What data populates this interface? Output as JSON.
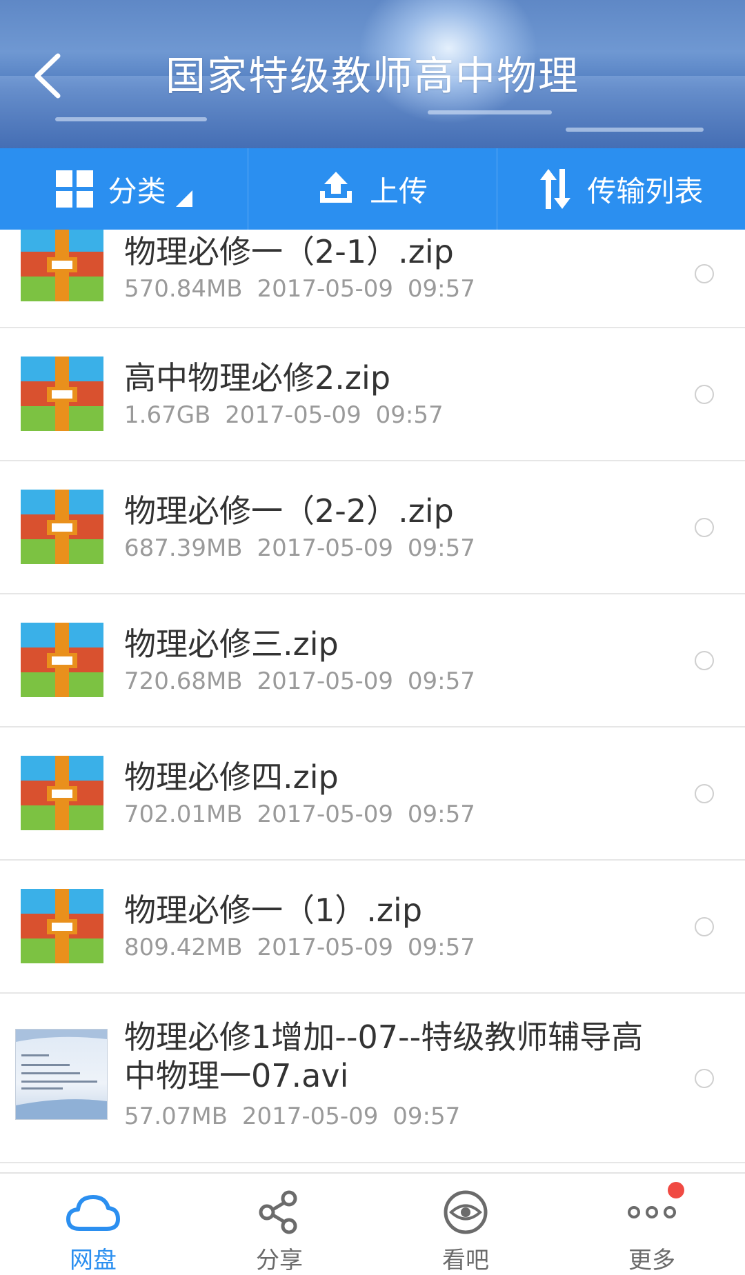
{
  "header": {
    "title": "国家特级教师高中物理"
  },
  "toolbar": {
    "category_label": "分类",
    "upload_label": "上传",
    "transfer_label": "传输列表"
  },
  "files": [
    {
      "name": "物理必修一（2-1）.zip",
      "size": "570.84MB",
      "date": "2017-05-09",
      "time": "09:57",
      "icon": "zip-archive-icon"
    },
    {
      "name": "高中物理必修2.zip",
      "size": "1.67GB",
      "date": "2017-05-09",
      "time": "09:57",
      "icon": "zip-archive-icon"
    },
    {
      "name": "物理必修一（2-2）.zip",
      "size": "687.39MB",
      "date": "2017-05-09",
      "time": "09:57",
      "icon": "zip-archive-icon"
    },
    {
      "name": "物理必修三.zip",
      "size": "720.68MB",
      "date": "2017-05-09",
      "time": "09:57",
      "icon": "zip-archive-icon"
    },
    {
      "name": "物理必修四.zip",
      "size": "702.01MB",
      "date": "2017-05-09",
      "time": "09:57",
      "icon": "zip-archive-icon"
    },
    {
      "name": "物理必修一（1）.zip",
      "size": "809.42MB",
      "date": "2017-05-09",
      "time": "09:57",
      "icon": "zip-archive-icon"
    },
    {
      "name": "物理必修1增加--07--特级教师辅导高中物理一07.avi",
      "size": "57.07MB",
      "date": "2017-05-09",
      "time": "09:57",
      "icon": "video-thumbnail"
    }
  ],
  "bottom_nav": [
    {
      "label": "网盘",
      "icon": "cloud-icon",
      "active": true
    },
    {
      "label": "分享",
      "icon": "share-icon",
      "active": false
    },
    {
      "label": "看吧",
      "icon": "eye-icon",
      "active": false
    },
    {
      "label": "更多",
      "icon": "more-icon",
      "active": false,
      "badge": true
    }
  ],
  "colors": {
    "accent": "#2b8ff0",
    "badge": "#f04a43",
    "zip_blue": "#3ab0e8",
    "zip_red": "#d9512f",
    "zip_green": "#7cc242",
    "zip_orange": "#e9901c"
  }
}
